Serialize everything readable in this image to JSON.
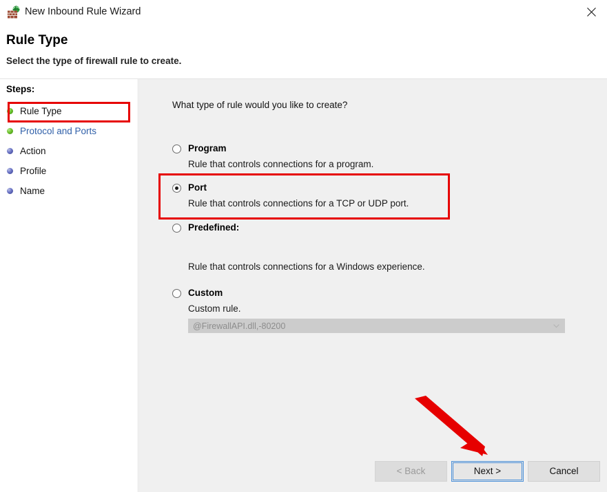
{
  "window": {
    "title": "New Inbound Rule Wizard",
    "icon": "firewall-globe-icon",
    "close_label": "Close"
  },
  "header": {
    "title": "Rule Type",
    "subtitle": "Select the type of firewall rule to create."
  },
  "sidebar": {
    "label": "Steps:",
    "items": [
      {
        "label": "Rule Type",
        "state": "green",
        "link": false
      },
      {
        "label": "Protocol and Ports",
        "state": "green",
        "link": true
      },
      {
        "label": "Action",
        "state": "blue",
        "link": false
      },
      {
        "label": "Profile",
        "state": "blue",
        "link": false
      },
      {
        "label": "Name",
        "state": "blue",
        "link": false
      }
    ]
  },
  "main": {
    "question": "What type of rule would you like to create?",
    "options": [
      {
        "title": "Program",
        "description": "Rule that controls connections for a program.",
        "selected": false
      },
      {
        "title": "Port",
        "description": "Rule that controls connections for a TCP or UDP port.",
        "selected": true
      },
      {
        "title": "Predefined:",
        "description": "Rule that controls connections for a Windows experience.",
        "selected": false
      },
      {
        "title": "Custom",
        "description": "Custom rule.",
        "selected": false
      }
    ],
    "predefined_combo": {
      "value": "@FirewallAPI.dll,-80200",
      "icon": "chevron-down-icon",
      "disabled": true
    }
  },
  "buttons": {
    "back": "< Back",
    "next": "Next >",
    "cancel": "Cancel"
  },
  "annotations": {
    "highlight_color": "#e60000",
    "arrow_color": "#e60000"
  }
}
